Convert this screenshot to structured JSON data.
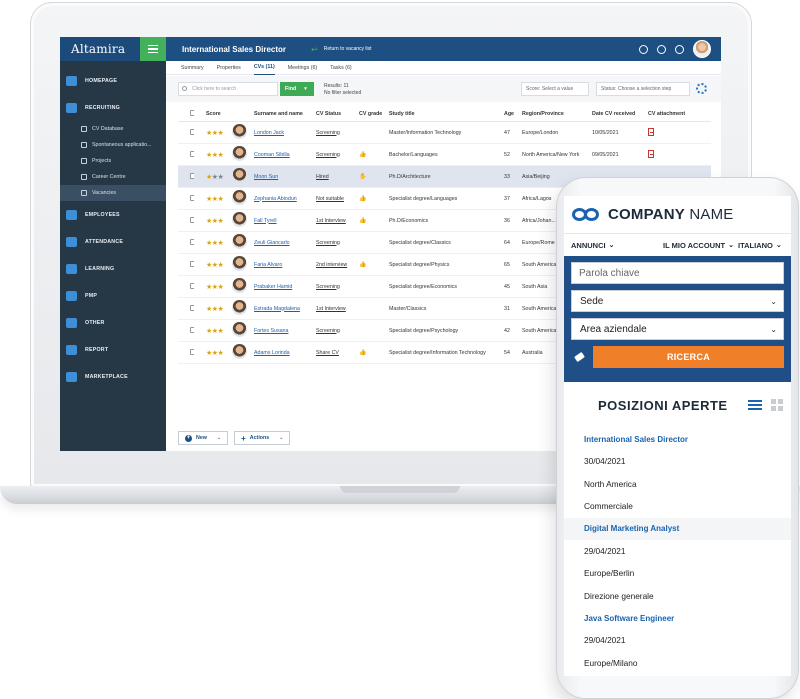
{
  "app": {
    "brand": "Altamira",
    "page_title": "International Sales Director",
    "back_link": "Return to vacancy list",
    "sidebar": {
      "items": [
        {
          "label": "HOMEPAGE"
        },
        {
          "label": "RECRUITING"
        },
        {
          "label": "EMPLOYEES"
        },
        {
          "label": "ATTENDANCE"
        },
        {
          "label": "LEARNING"
        },
        {
          "label": "PMP"
        },
        {
          "label": "OTHER"
        },
        {
          "label": "REPORT"
        },
        {
          "label": "MARKETPLACE"
        }
      ],
      "recruiting_sub": [
        {
          "label": "CV Database"
        },
        {
          "label": "Spontaneous applicatio..."
        },
        {
          "label": "Projects"
        },
        {
          "label": "Career Centre"
        },
        {
          "label": "Vacancies"
        }
      ]
    },
    "tabs": [
      "Summary",
      "Properties",
      "CVs (11)",
      "Meetings (6)",
      "Tasks (6)"
    ],
    "active_tab": "CVs (11)",
    "search_placeholder": "Click here to search",
    "find_label": "Find",
    "results_line1": "Results: 11",
    "results_line2": "No filter selected",
    "score_select": "Score: Select a value",
    "status_select": "Status: Choose a selection step",
    "columns": [
      "Score",
      "Surname and name",
      "CV Status",
      "CV grade",
      "Study title",
      "Age",
      "Region/Province",
      "Date CV received",
      "CV attachment"
    ],
    "rows": [
      {
        "stars": 3,
        "name": "London Jack",
        "status": "Screening",
        "grade": "",
        "study": "Master/Information Technology",
        "age": "47",
        "region": "Europe/London",
        "date": "10/05/2021",
        "pdf": true
      },
      {
        "stars": 3,
        "name": "Cooman Sibilla",
        "status": "Screening",
        "grade": "👍",
        "study": "Bachelor/Languages",
        "age": "52",
        "region": "North America/New York",
        "date": "09/05/2021",
        "pdf": true
      },
      {
        "stars": 1,
        "name": "Moon Sun",
        "status": "Hired",
        "grade": "✋",
        "study": "Ph.D/Architecture",
        "age": "33",
        "region": "Asia/Beijing",
        "date": "",
        "pdf": false,
        "selected": true
      },
      {
        "stars": 3,
        "name": "Zephania Abiodun",
        "status": "Not suitable",
        "grade": "👍",
        "study": "Specialist degree/Languages",
        "age": "37",
        "region": "Africa/Lagos",
        "date": "",
        "pdf": false
      },
      {
        "stars": 3,
        "name": "Fall Tyrell",
        "status": "1st Interview",
        "grade": "👍",
        "study": "Ph.D/Economics",
        "age": "36",
        "region": "Africa/Johan...",
        "date": "",
        "pdf": false
      },
      {
        "stars": 3,
        "name": "Zeuli Giancarlo",
        "status": "Screening",
        "grade": "",
        "study": "Specialist degree/Classics",
        "age": "64",
        "region": "Europe/Rome",
        "date": "",
        "pdf": false
      },
      {
        "stars": 3,
        "name": "Faria Alvaro",
        "status": "2nd interview",
        "grade": "👍",
        "study": "Specialist degree/Physics",
        "age": "65",
        "region": "South America",
        "date": "",
        "pdf": false
      },
      {
        "stars": 3,
        "name": "Prabaker Hamid",
        "status": "Screening",
        "grade": "",
        "study": "Specialist degree/Economics",
        "age": "45",
        "region": "South Asia",
        "date": "",
        "pdf": false
      },
      {
        "stars": 3,
        "name": "Estrada Magdalena",
        "status": "1st Interview",
        "grade": "",
        "study": "Master/Classics",
        "age": "31",
        "region": "South America",
        "date": "",
        "pdf": false
      },
      {
        "stars": 3,
        "name": "Fortes Susana",
        "status": "Screening",
        "grade": "",
        "study": "Specialist degree/Psychology",
        "age": "42",
        "region": "South America",
        "date": "",
        "pdf": false
      },
      {
        "stars": 3,
        "name": "Adams Lorinda",
        "status": "Share CV",
        "grade": "👍",
        "study": "Specialist degree/Information Technology",
        "age": "54",
        "region": "Australia",
        "date": "",
        "pdf": false
      }
    ],
    "new_button": "New",
    "actions_button": "Actions"
  },
  "mobile": {
    "company_name_bold": "COMPANY",
    "company_name_rest": " NAME",
    "nav": [
      "ANNUNCI",
      "IL MIO ACCOUNT",
      "ITALIANO"
    ],
    "keyword_placeholder": "Parola chiave",
    "sede": "Sede",
    "area": "Area aziendale",
    "search_button": "RICERCA",
    "section_title": "POSIZIONI APERTE",
    "jobs": [
      {
        "title": "International Sales Director",
        "date": "30/04/2021",
        "location": "North America",
        "area": "Commerciale"
      },
      {
        "title": "Digital Marketing Analyst",
        "date": "29/04/2021",
        "location": "Europe/Berlin",
        "area": "Direzione generale"
      },
      {
        "title": "Java Software Engineer",
        "date": "29/04/2021",
        "location": "Europe/Milano",
        "area": ""
      }
    ]
  },
  "colors": {
    "header_blue": "#1d4f83",
    "sidebar_dark": "#263746",
    "accent_green": "#43b05c",
    "orange": "#f07f2a",
    "star_gold": "#d9a515"
  }
}
